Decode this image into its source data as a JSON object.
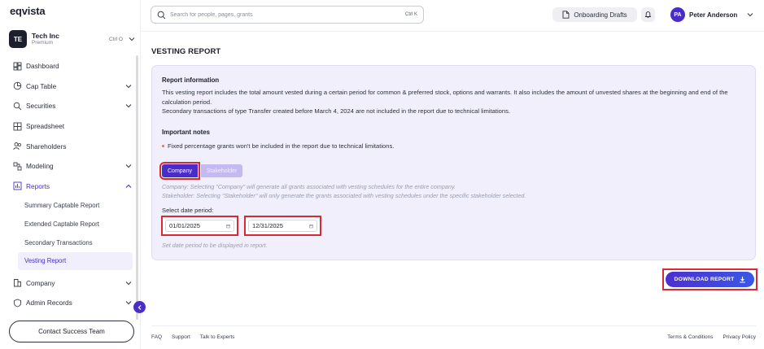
{
  "brand": {
    "logo": "eqvista",
    "accent": "#4a2dc8",
    "highlight": "#d82a36"
  },
  "org": {
    "badge": "TE",
    "name": "Tech Inc",
    "plan": "Premium",
    "shortcut": "Ctrl O"
  },
  "sidebar": {
    "items": [
      {
        "label": "Dashboard",
        "icon": "dashboard-icon"
      },
      {
        "label": "Cap Table",
        "icon": "pie-chart-icon"
      },
      {
        "label": "Securities",
        "icon": "securities-icon"
      },
      {
        "label": "Spreadsheet",
        "icon": "grid-icon"
      },
      {
        "label": "Shareholders",
        "icon": "users-icon"
      },
      {
        "label": "Modeling",
        "icon": "modeling-icon"
      },
      {
        "label": "Reports",
        "icon": "reports-icon"
      },
      {
        "label": "Company",
        "icon": "company-icon"
      },
      {
        "label": "Admin Records",
        "icon": "admin-icon"
      }
    ],
    "report_subitems": [
      "Summary Captable Report",
      "Extended Captable Report",
      "Secondary Transactions",
      "Vesting Report"
    ],
    "contact_button": "Contact Success Team"
  },
  "topbar": {
    "search_placeholder": "Search for people, pages, grants",
    "search_shortcut": "Ctrl K",
    "drafts_label": "Onboarding Drafts",
    "user_initials": "PA",
    "user_name": "Peter Anderson"
  },
  "main": {
    "title": "VESTING REPORT",
    "info_heading": "Report information",
    "info_text_1": "This vesting report includes the total amount vested during a certain period for common & preferred stock, options and warrants. It also includes the amount of unvested shares at the beginning and end of the calculation period.",
    "info_text_2": "Secondary transactions of type Transfer created before March 4, 2024 are not included in the report due to technical limitations.",
    "notes_heading": "Important notes",
    "note_1": "Fixed percentage grants won't be included in the report due to technical limitations.",
    "toggle_company": "Company",
    "toggle_stakeholder": "Stakeholder",
    "helper_company": "Company: Selecting \"Company\" will generate all grants associated with vesting schedules for the entire company.",
    "helper_stakeholder": "Stakeholder: Selecting \"Stakeholder\" will only generate the grants associated with vesting schedules under the specific stakeholder selected.",
    "period_label": "Select date period:",
    "start_date": "01/01/2025",
    "end_date": "12/31/2025",
    "period_helper": "Set date period to be displayed in report.",
    "download_button": "DOWNLOAD REPORT"
  },
  "footer": {
    "left_links": [
      "FAQ",
      "Support",
      "Talk to Experts"
    ],
    "right_links": [
      "Terms & Conditions",
      "Privacy Policy"
    ]
  }
}
